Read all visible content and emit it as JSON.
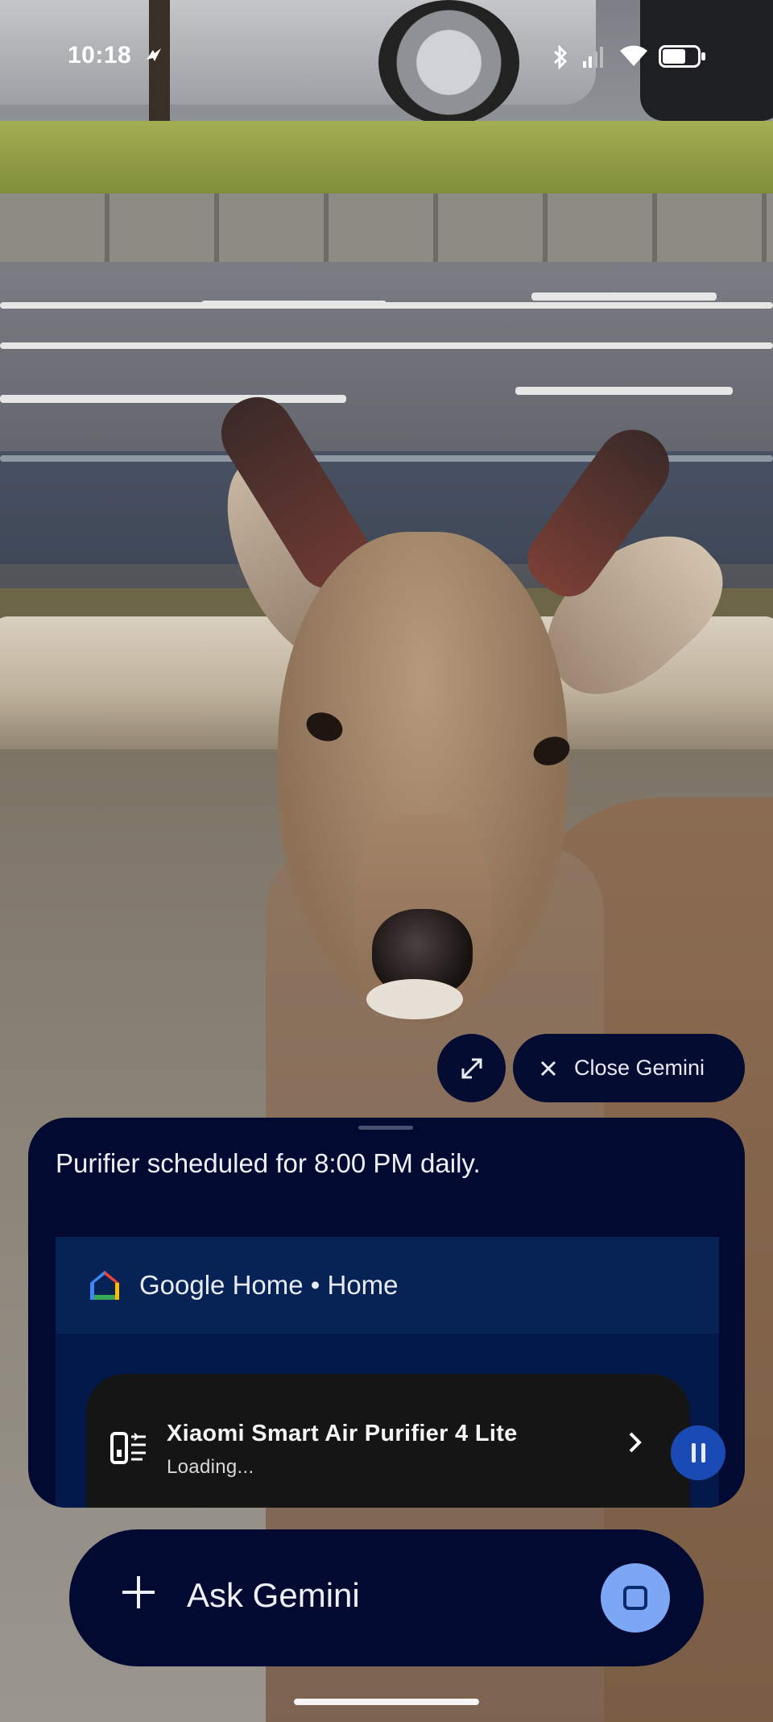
{
  "status_bar": {
    "time": "10:18",
    "icons": [
      "nfc-icon",
      "bluetooth-icon",
      "signal-icon",
      "wifi-icon",
      "battery-icon"
    ]
  },
  "controls": {
    "expand_icon": "expand-icon",
    "close_label": "Close Gemini"
  },
  "gemini_panel": {
    "response_text": "Purifier scheduled for 8:00 PM daily.",
    "home_card": {
      "title": "Google Home • Home",
      "icon": "google-home-icon",
      "device": {
        "name": "Xiaomi Smart Air Purifier 4 Lite",
        "status": "Loading...",
        "icon": "air-purifier-icon"
      }
    }
  },
  "ask_bar": {
    "placeholder": "Ask Gemini",
    "add_icon": "plus-icon",
    "stop_icon": "stop-icon"
  },
  "colors": {
    "panel_bg": "#030a32",
    "card_bg": "#062055",
    "tile_bg": "#161516",
    "pause_bg": "#1a4bb4",
    "stop_bg": "#7da7f5"
  }
}
